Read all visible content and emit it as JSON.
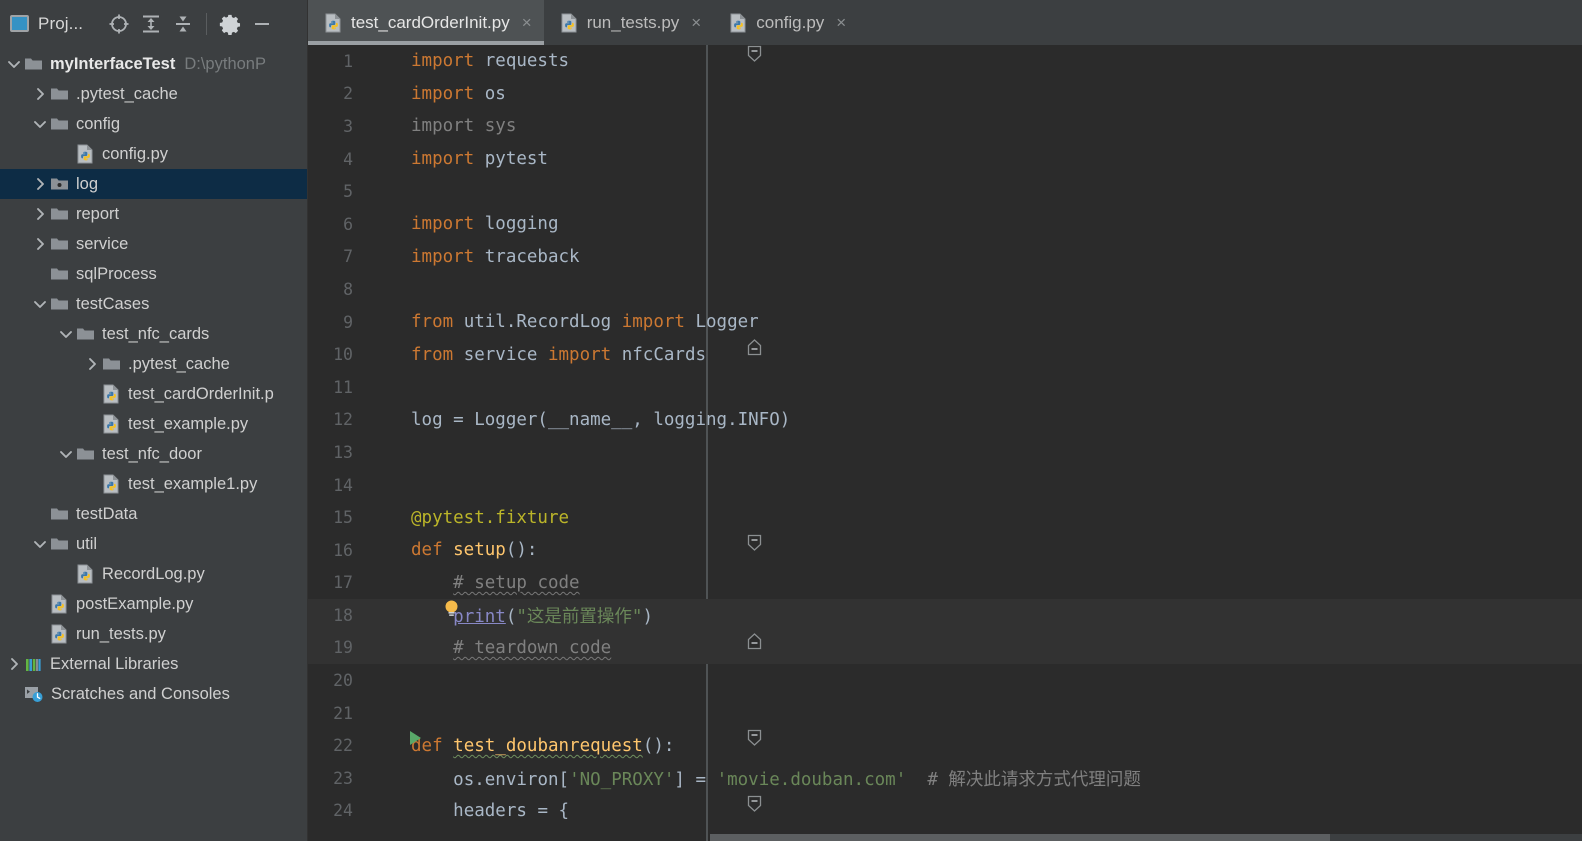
{
  "window": {
    "background": "#2b2b2b",
    "sidebar_bg": "#3c3f41",
    "accent": "#3592c4",
    "selection_bg": "#0d2c45"
  },
  "toolwindow": {
    "title": "Proj...",
    "buttons": [
      {
        "name": "select-opened-file-icon",
        "tooltip": "Select Opened File"
      },
      {
        "name": "expand-all-icon",
        "tooltip": "Expand All"
      },
      {
        "name": "collapse-all-icon",
        "tooltip": "Collapse All"
      },
      {
        "name": "settings-gear-icon",
        "tooltip": "Options"
      },
      {
        "name": "hide-icon",
        "tooltip": "Hide"
      }
    ]
  },
  "tree": {
    "items": [
      {
        "label": "myInterfaceTest",
        "suffix": "D:\\pythonP",
        "indent": 0,
        "toggle": "down",
        "icon": "folder-module",
        "bold": true,
        "selected": false
      },
      {
        "label": ".pytest_cache",
        "suffix": "",
        "indent": 1,
        "toggle": "right",
        "icon": "folder",
        "bold": false,
        "selected": false
      },
      {
        "label": "config",
        "suffix": "",
        "indent": 1,
        "toggle": "down",
        "icon": "folder",
        "bold": false,
        "selected": false
      },
      {
        "label": "config.py",
        "suffix": "",
        "indent": 2,
        "toggle": "none",
        "icon": "python-file",
        "bold": false,
        "selected": false
      },
      {
        "label": "log",
        "suffix": "",
        "indent": 1,
        "toggle": "right",
        "icon": "folder-source",
        "bold": false,
        "selected": true
      },
      {
        "label": "report",
        "suffix": "",
        "indent": 1,
        "toggle": "right",
        "icon": "folder",
        "bold": false,
        "selected": false
      },
      {
        "label": "service",
        "suffix": "",
        "indent": 1,
        "toggle": "right",
        "icon": "folder",
        "bold": false,
        "selected": false
      },
      {
        "label": "sqlProcess",
        "suffix": "",
        "indent": 1,
        "toggle": "none",
        "icon": "folder",
        "bold": false,
        "selected": false
      },
      {
        "label": "testCases",
        "suffix": "",
        "indent": 1,
        "toggle": "down",
        "icon": "folder",
        "bold": false,
        "selected": false
      },
      {
        "label": "test_nfc_cards",
        "suffix": "",
        "indent": 2,
        "toggle": "down",
        "icon": "folder",
        "bold": false,
        "selected": false
      },
      {
        "label": ".pytest_cache",
        "suffix": "",
        "indent": 3,
        "toggle": "right",
        "icon": "folder",
        "bold": false,
        "selected": false
      },
      {
        "label": "test_cardOrderInit.p",
        "suffix": "",
        "indent": 3,
        "toggle": "none",
        "icon": "python-file",
        "bold": false,
        "selected": false
      },
      {
        "label": "test_example.py",
        "suffix": "",
        "indent": 3,
        "toggle": "none",
        "icon": "python-file",
        "bold": false,
        "selected": false
      },
      {
        "label": "test_nfc_door",
        "suffix": "",
        "indent": 2,
        "toggle": "down",
        "icon": "folder",
        "bold": false,
        "selected": false
      },
      {
        "label": "test_example1.py",
        "suffix": "",
        "indent": 3,
        "toggle": "none",
        "icon": "python-file",
        "bold": false,
        "selected": false
      },
      {
        "label": "testData",
        "suffix": "",
        "indent": 1,
        "toggle": "none",
        "icon": "folder",
        "bold": false,
        "selected": false
      },
      {
        "label": "util",
        "suffix": "",
        "indent": 1,
        "toggle": "down",
        "icon": "folder",
        "bold": false,
        "selected": false
      },
      {
        "label": "RecordLog.py",
        "suffix": "",
        "indent": 2,
        "toggle": "none",
        "icon": "python-file",
        "bold": false,
        "selected": false
      },
      {
        "label": "postExample.py",
        "suffix": "",
        "indent": 1,
        "toggle": "none",
        "icon": "python-file",
        "bold": false,
        "selected": false
      },
      {
        "label": "run_tests.py",
        "suffix": "",
        "indent": 1,
        "toggle": "none",
        "icon": "python-file",
        "bold": false,
        "selected": false
      },
      {
        "label": "External Libraries",
        "suffix": "",
        "indent": 0,
        "toggle": "right",
        "icon": "libraries",
        "bold": false,
        "selected": false
      },
      {
        "label": "Scratches and Consoles",
        "suffix": "",
        "indent": 0,
        "toggle": "none",
        "icon": "scratches",
        "bold": false,
        "selected": false
      }
    ]
  },
  "tabs": [
    {
      "label": "test_cardOrderInit.py",
      "icon": "python-file",
      "active": true,
      "close": "×"
    },
    {
      "label": "run_tests.py",
      "icon": "python-file",
      "active": false,
      "close": "×"
    },
    {
      "label": "config.py",
      "icon": "python-file",
      "active": false,
      "close": "×"
    }
  ],
  "editor": {
    "filename": "test_cardOrderInit.py",
    "first_visible_line": 1,
    "last_visible_line": 24,
    "lines": [
      {
        "n": 1,
        "text": "import requests",
        "fold": "collapse-minus",
        "marker": "",
        "highlight": false
      },
      {
        "n": 2,
        "text": "import os",
        "fold": "",
        "marker": "",
        "highlight": false
      },
      {
        "n": 3,
        "text": "import sys",
        "fold": "",
        "marker": "",
        "highlight": false
      },
      {
        "n": 4,
        "text": "import pytest",
        "fold": "",
        "marker": "",
        "highlight": false
      },
      {
        "n": 5,
        "text": "",
        "fold": "",
        "marker": "",
        "highlight": false
      },
      {
        "n": 6,
        "text": "import logging",
        "fold": "",
        "marker": "",
        "highlight": false
      },
      {
        "n": 7,
        "text": "import traceback",
        "fold": "",
        "marker": "",
        "highlight": false
      },
      {
        "n": 8,
        "text": "",
        "fold": "",
        "marker": "",
        "highlight": false
      },
      {
        "n": 9,
        "text": "from util.RecordLog import Logger",
        "fold": "",
        "marker": "",
        "highlight": false
      },
      {
        "n": 10,
        "text": "from service import nfcCards",
        "fold": "expand-end",
        "marker": "",
        "highlight": false
      },
      {
        "n": 11,
        "text": "",
        "fold": "",
        "marker": "",
        "highlight": false
      },
      {
        "n": 12,
        "text": "log = Logger(__name__, logging.INFO)",
        "fold": "",
        "marker": "",
        "highlight": false
      },
      {
        "n": 13,
        "text": "",
        "fold": "",
        "marker": "",
        "highlight": false
      },
      {
        "n": 14,
        "text": "",
        "fold": "",
        "marker": "",
        "highlight": false
      },
      {
        "n": 15,
        "text": "@pytest.fixture",
        "fold": "",
        "marker": "",
        "highlight": false
      },
      {
        "n": 16,
        "text": "def setup():",
        "fold": "collapse-minus",
        "marker": "",
        "highlight": false
      },
      {
        "n": 17,
        "text": "    # setup code",
        "fold": "",
        "marker": "",
        "highlight": false
      },
      {
        "n": 18,
        "text": "    print(\"这是前置操作\")",
        "fold": "",
        "marker": "lightbulb",
        "highlight": true
      },
      {
        "n": 19,
        "text": "    # teardown code",
        "fold": "expand-end",
        "marker": "",
        "highlight": true
      },
      {
        "n": 20,
        "text": "",
        "fold": "",
        "marker": "",
        "highlight": false
      },
      {
        "n": 21,
        "text": "",
        "fold": "",
        "marker": "",
        "highlight": false
      },
      {
        "n": 22,
        "text": "def test_doubanrequest():",
        "fold": "collapse-minus",
        "marker": "run-arrow",
        "highlight": false
      },
      {
        "n": 23,
        "text": "    os.environ['NO_PROXY'] = 'movie.douban.com'  # 解决此请求方式代理问题",
        "fold": "",
        "marker": "",
        "highlight": false
      },
      {
        "n": 24,
        "text": "    headers = {",
        "fold": "collapse-minus",
        "marker": "",
        "highlight": false
      }
    ],
    "syntax_colors": {
      "keyword": "#cc7832",
      "string": "#6a8759",
      "comment": "#808080",
      "function": "#ffc66d",
      "decorator": "#bbb529",
      "identifier": "#a9b7c6",
      "unused": "#808080",
      "builtin": "#8888c6",
      "line_number": "#606366"
    }
  }
}
